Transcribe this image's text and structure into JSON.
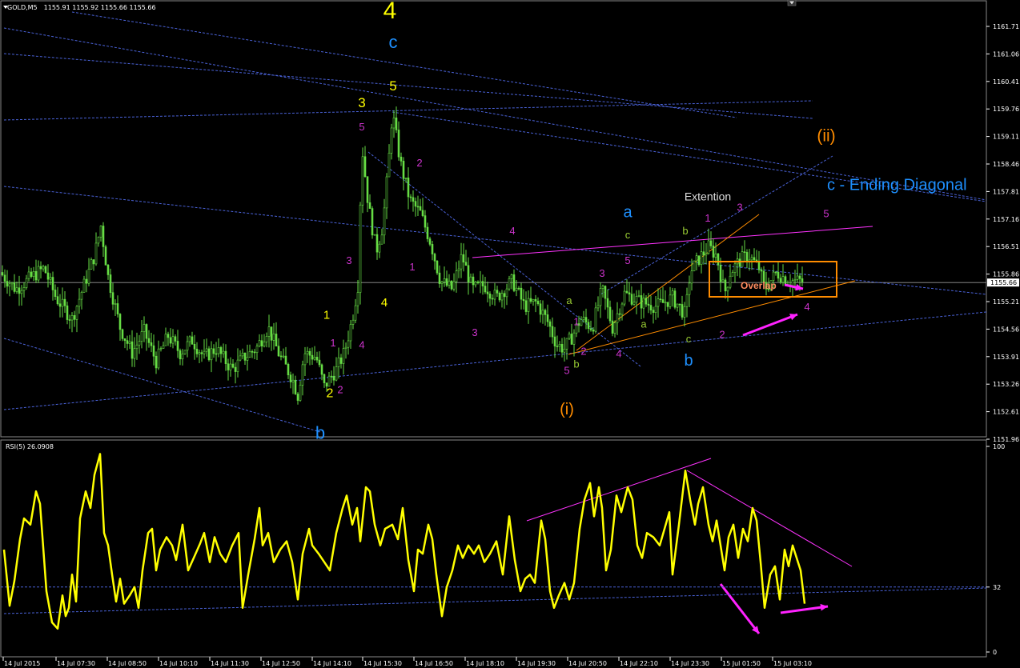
{
  "chart_data": [
    {
      "type": "candlestick",
      "title": "GOLD,M5",
      "header": {
        "symbol": "GOLD,M5",
        "quote": "1155.91 1155.92 1155.66 1155.66"
      },
      "price_axis": {
        "ticks": [
          "1161.71",
          "1161.06",
          "1160.41",
          "1159.76",
          "1159.11",
          "1158.46",
          "1157.81",
          "1157.16",
          "1156.51",
          "1155.86",
          "1155.21",
          "1154.56",
          "1153.91",
          "1153.26",
          "1152.61",
          "1151.96"
        ],
        "current_price": "1155.66",
        "ylim": [
          1151.8,
          1162.2
        ]
      },
      "time_axis": {
        "ticks": [
          "14 Jul 2015",
          "14 Jul 07:30",
          "14 Jul 08:50",
          "14 Jul 10:10",
          "14 Jul 11:30",
          "14 Jul 12:50",
          "14 Jul 14:10",
          "14 Jul 15:30",
          "14 Jul 16:50",
          "14 Jul 18:10",
          "14 Jul 19:30",
          "14 Jul 20:50",
          "14 Jul 22:10",
          "14 Jul 23:30",
          "15 Jul 01:50",
          "15 Jul 03:10"
        ]
      },
      "close_path": [
        [
          0,
          1155.9
        ],
        [
          20,
          1155.5
        ],
        [
          40,
          1155.8
        ],
        [
          55,
          1156.0
        ],
        [
          70,
          1155.3
        ],
        [
          90,
          1154.8
        ],
        [
          105,
          1155.6
        ],
        [
          118,
          1156.3
        ],
        [
          126,
          1157.0
        ],
        [
          135,
          1155.8
        ],
        [
          150,
          1154.6
        ],
        [
          165,
          1154.0
        ],
        [
          180,
          1154.5
        ],
        [
          195,
          1153.8
        ],
        [
          210,
          1154.4
        ],
        [
          225,
          1154.0
        ],
        [
          240,
          1154.3
        ],
        [
          255,
          1153.9
        ],
        [
          270,
          1154.1
        ],
        [
          290,
          1153.6
        ],
        [
          305,
          1153.9
        ],
        [
          320,
          1154.1
        ],
        [
          335,
          1154.6
        ],
        [
          350,
          1153.9
        ],
        [
          365,
          1153.4
        ],
        [
          372,
          1153.0
        ],
        [
          380,
          1154.0
        ],
        [
          395,
          1153.9
        ],
        [
          405,
          1153.2
        ],
        [
          412,
          1153.4
        ],
        [
          420,
          1153.6
        ],
        [
          430,
          1154.0
        ],
        [
          440,
          1154.8
        ],
        [
          447,
          1155.6
        ],
        [
          452,
          1158.9
        ],
        [
          460,
          1157.5
        ],
        [
          470,
          1156.4
        ],
        [
          478,
          1157.0
        ],
        [
          485,
          1158.4
        ],
        [
          490,
          1159.7
        ],
        [
          500,
          1158.5
        ],
        [
          512,
          1157.6
        ],
        [
          525,
          1157.3
        ],
        [
          538,
          1156.6
        ],
        [
          550,
          1155.7
        ],
        [
          565,
          1155.5
        ],
        [
          577,
          1156.3
        ],
        [
          590,
          1155.5
        ],
        [
          605,
          1155.6
        ],
        [
          620,
          1155.3
        ],
        [
          640,
          1155.7
        ],
        [
          655,
          1155.1
        ],
        [
          670,
          1155.2
        ],
        [
          685,
          1154.7
        ],
        [
          695,
          1154.2
        ],
        [
          705,
          1154.1
        ],
        [
          715,
          1154.4
        ],
        [
          725,
          1154.8
        ],
        [
          740,
          1154.6
        ],
        [
          752,
          1155.5
        ],
        [
          765,
          1154.6
        ],
        [
          780,
          1155.4
        ],
        [
          800,
          1155.2
        ],
        [
          820,
          1155.1
        ],
        [
          840,
          1155.3
        ],
        [
          856,
          1154.9
        ],
        [
          862,
          1155.9
        ],
        [
          872,
          1156.2
        ],
        [
          885,
          1156.5
        ],
        [
          895,
          1156.3
        ],
        [
          905,
          1155.4
        ],
        [
          912,
          1155.9
        ],
        [
          925,
          1156.2
        ],
        [
          935,
          1156.3
        ],
        [
          948,
          1156.0
        ],
        [
          955,
          1155.5
        ],
        [
          970,
          1155.9
        ],
        [
          985,
          1155.7
        ],
        [
          1000,
          1155.7
        ],
        [
          1005,
          1155.66
        ]
      ],
      "labels": [
        {
          "text": "4",
          "x": 487,
          "y": 1161.9,
          "color": "#ffff00",
          "size": 30
        },
        {
          "text": "c",
          "x": 491,
          "y": 1161.2,
          "color": "#1e90ff",
          "size": 22
        },
        {
          "text": "5",
          "x": 491,
          "y": 1160.2,
          "color": "#ffff00",
          "size": 17
        },
        {
          "text": "3",
          "x": 452,
          "y": 1159.8,
          "color": "#ffff00",
          "size": 17
        },
        {
          "text": "5",
          "x": 452,
          "y": 1159.25,
          "color": "#cc33cc",
          "size": 13
        },
        {
          "text": "2",
          "x": 524,
          "y": 1158.4,
          "color": "#cc33cc",
          "size": 13
        },
        {
          "text": "4",
          "x": 640,
          "y": 1156.8,
          "color": "#cc33cc",
          "size": 13
        },
        {
          "text": "1",
          "x": 515,
          "y": 1155.95,
          "color": "#cc33cc",
          "size": 13
        },
        {
          "text": "3",
          "x": 436,
          "y": 1156.1,
          "color": "#cc33cc",
          "size": 13
        },
        {
          "text": "4",
          "x": 480,
          "y": 1155.1,
          "color": "#ffff00",
          "size": 15
        },
        {
          "text": "1",
          "x": 408,
          "y": 1154.8,
          "color": "#ffff00",
          "size": 15
        },
        {
          "text": "1",
          "x": 416,
          "y": 1154.15,
          "color": "#cc33cc",
          "size": 13
        },
        {
          "text": "4",
          "x": 452,
          "y": 1154.1,
          "color": "#cc33cc",
          "size": 13
        },
        {
          "text": "2",
          "x": 412,
          "y": 1152.95,
          "color": "#ffff00",
          "size": 16
        },
        {
          "text": "2",
          "x": 425,
          "y": 1153.05,
          "color": "#cc33cc",
          "size": 13
        },
        {
          "text": "b",
          "x": 400,
          "y": 1151.97,
          "color": "#1e90ff",
          "size": 22
        },
        {
          "text": "3",
          "x": 593,
          "y": 1154.4,
          "color": "#cc33cc",
          "size": 13
        },
        {
          "text": "(i)",
          "x": 708,
          "y": 1152.55,
          "color": "#ff8c00",
          "size": 20
        },
        {
          "text": "5",
          "x": 708,
          "y": 1153.5,
          "color": "#cc33cc",
          "size": 13
        },
        {
          "text": "b",
          "x": 720,
          "y": 1153.65,
          "color": "#99cc33",
          "size": 13
        },
        {
          "text": "2",
          "x": 729,
          "y": 1153.95,
          "color": "#cc33cc",
          "size": 13
        },
        {
          "text": "4",
          "x": 773,
          "y": 1153.9,
          "color": "#cc33cc",
          "size": 13
        },
        {
          "text": "1",
          "x": 720,
          "y": 1154.65,
          "color": "#cc33cc",
          "size": 13
        },
        {
          "text": "a",
          "x": 711,
          "y": 1155.15,
          "color": "#99cc33",
          "size": 13
        },
        {
          "text": "3",
          "x": 752,
          "y": 1155.8,
          "color": "#cc33cc",
          "size": 13
        },
        {
          "text": "5",
          "x": 784,
          "y": 1156.1,
          "color": "#cc33cc",
          "size": 13
        },
        {
          "text": "c",
          "x": 784,
          "y": 1156.7,
          "color": "#99cc33",
          "size": 13
        },
        {
          "text": "a",
          "x": 784,
          "y": 1157.2,
          "color": "#1e90ff",
          "size": 20
        },
        {
          "text": "a",
          "x": 804,
          "y": 1154.6,
          "color": "#99cc33",
          "size": 13
        },
        {
          "text": "c",
          "x": 860,
          "y": 1154.25,
          "color": "#99cc33",
          "size": 13
        },
        {
          "text": "b",
          "x": 860,
          "y": 1153.7,
          "color": "#1e90ff",
          "size": 20
        },
        {
          "text": "b",
          "x": 856,
          "y": 1156.8,
          "color": "#99cc33",
          "size": 13
        },
        {
          "text": "1",
          "x": 884,
          "y": 1157.1,
          "color": "#cc33cc",
          "size": 13
        },
        {
          "text": "Extention",
          "x": 884,
          "y": 1157.6,
          "color": "#dddddd",
          "size": 14
        },
        {
          "text": "3",
          "x": 924,
          "y": 1157.35,
          "color": "#cc33cc",
          "size": 13
        },
        {
          "text": "2",
          "x": 902,
          "y": 1154.35,
          "color": "#cc33cc",
          "size": 13
        },
        {
          "text": "4",
          "x": 1008,
          "y": 1155.0,
          "color": "#cc33cc",
          "size": 13
        },
        {
          "text": "5",
          "x": 1032,
          "y": 1157.2,
          "color": "#cc33cc",
          "size": 13
        },
        {
          "text": "(ii)",
          "x": 1032,
          "y": 1159.0,
          "color": "#ff8c00",
          "size": 21
        },
        {
          "text": "c - Ending Diagonal",
          "x": 1033,
          "y": 1157.85,
          "color": "#1e90ff",
          "size": 20,
          "anchor": "start"
        }
      ],
      "box_label": "Overlap"
    },
    {
      "type": "line",
      "title": "RSI(5) 26.0908",
      "header": "RSI(5) 26.0908",
      "y_ticks": [
        "100",
        "32",
        "0"
      ],
      "ylim": [
        0,
        100
      ],
      "level": 32,
      "rsi_points": [
        [
          5,
          50
        ],
        [
          12,
          23
        ],
        [
          18,
          35
        ],
        [
          25,
          55
        ],
        [
          30,
          65
        ],
        [
          38,
          62
        ],
        [
          45,
          78
        ],
        [
          50,
          72
        ],
        [
          58,
          30
        ],
        [
          65,
          15
        ],
        [
          72,
          12
        ],
        [
          78,
          28
        ],
        [
          82,
          18
        ],
        [
          86,
          22
        ],
        [
          90,
          38
        ],
        [
          95,
          25
        ],
        [
          100,
          65
        ],
        [
          107,
          78
        ],
        [
          113,
          70
        ],
        [
          118,
          86
        ],
        [
          125,
          96
        ],
        [
          130,
          58
        ],
        [
          135,
          52
        ],
        [
          140,
          38
        ],
        [
          145,
          25
        ],
        [
          150,
          36
        ],
        [
          155,
          24
        ],
        [
          162,
          28
        ],
        [
          168,
          32
        ],
        [
          173,
          22
        ],
        [
          178,
          40
        ],
        [
          185,
          58
        ],
        [
          190,
          60
        ],
        [
          195,
          40
        ],
        [
          200,
          50
        ],
        [
          208,
          56
        ],
        [
          215,
          52
        ],
        [
          220,
          45
        ],
        [
          228,
          62
        ],
        [
          235,
          40
        ],
        [
          242,
          46
        ],
        [
          250,
          53
        ],
        [
          255,
          58
        ],
        [
          262,
          44
        ],
        [
          268,
          56
        ],
        [
          275,
          48
        ],
        [
          282,
          44
        ],
        [
          290,
          52
        ],
        [
          298,
          58
        ],
        [
          303,
          22
        ],
        [
          310,
          38
        ],
        [
          318,
          55
        ],
        [
          324,
          70
        ],
        [
          328,
          52
        ],
        [
          335,
          58
        ],
        [
          342,
          44
        ],
        [
          350,
          50
        ],
        [
          358,
          54
        ],
        [
          365,
          44
        ],
        [
          372,
          26
        ],
        [
          378,
          48
        ],
        [
          386,
          60
        ],
        [
          390,
          52
        ],
        [
          398,
          48
        ],
        [
          405,
          44
        ],
        [
          412,
          40
        ],
        [
          420,
          58
        ],
        [
          428,
          70
        ],
        [
          433,
          76
        ],
        [
          440,
          62
        ],
        [
          446,
          70
        ],
        [
          450,
          54
        ],
        [
          457,
          80
        ],
        [
          462,
          78
        ],
        [
          468,
          62
        ],
        [
          475,
          52
        ],
        [
          481,
          60
        ],
        [
          490,
          62
        ],
        [
          497,
          55
        ],
        [
          503,
          70
        ],
        [
          510,
          45
        ],
        [
          517,
          30
        ],
        [
          522,
          50
        ],
        [
          528,
          48
        ],
        [
          535,
          62
        ],
        [
          540,
          55
        ],
        [
          545,
          38
        ],
        [
          552,
          18
        ],
        [
          558,
          32
        ],
        [
          565,
          40
        ],
        [
          572,
          52
        ],
        [
          578,
          46
        ],
        [
          585,
          52
        ],
        [
          592,
          48
        ],
        [
          598,
          52
        ],
        [
          605,
          44
        ],
        [
          612,
          48
        ],
        [
          620,
          54
        ],
        [
          628,
          38
        ],
        [
          636,
          66
        ],
        [
          643,
          45
        ],
        [
          650,
          30
        ],
        [
          656,
          36
        ],
        [
          662,
          38
        ],
        [
          668,
          34
        ],
        [
          676,
          64
        ],
        [
          681,
          55
        ],
        [
          687,
          30
        ],
        [
          692,
          22
        ],
        [
          698,
          28
        ],
        [
          705,
          34
        ],
        [
          711,
          26
        ],
        [
          717,
          34
        ],
        [
          724,
          60
        ],
        [
          730,
          74
        ],
        [
          737,
          82
        ],
        [
          742,
          66
        ],
        [
          748,
          80
        ],
        [
          752,
          70
        ],
        [
          757,
          40
        ],
        [
          763,
          50
        ],
        [
          770,
          76
        ],
        [
          776,
          68
        ],
        [
          784,
          80
        ],
        [
          790,
          74
        ],
        [
          796,
          52
        ],
        [
          802,
          46
        ],
        [
          808,
          58
        ],
        [
          816,
          56
        ],
        [
          824,
          52
        ],
        [
          830,
          60
        ],
        [
          836,
          68
        ],
        [
          840,
          38
        ],
        [
          848,
          62
        ],
        [
          856,
          88
        ],
        [
          862,
          74
        ],
        [
          868,
          62
        ],
        [
          872,
          72
        ],
        [
          878,
          80
        ],
        [
          885,
          62
        ],
        [
          890,
          54
        ],
        [
          895,
          64
        ],
        [
          900,
          52
        ],
        [
          905,
          40
        ],
        [
          910,
          56
        ],
        [
          916,
          62
        ],
        [
          922,
          46
        ],
        [
          928,
          60
        ],
        [
          934,
          54
        ],
        [
          940,
          70
        ],
        [
          945,
          64
        ],
        [
          950,
          44
        ],
        [
          955,
          22
        ],
        [
          962,
          38
        ],
        [
          968,
          42
        ],
        [
          974,
          26
        ],
        [
          980,
          50
        ],
        [
          985,
          42
        ],
        [
          990,
          52
        ],
        [
          995,
          46
        ],
        [
          1000,
          40
        ],
        [
          1005,
          24
        ]
      ]
    }
  ]
}
